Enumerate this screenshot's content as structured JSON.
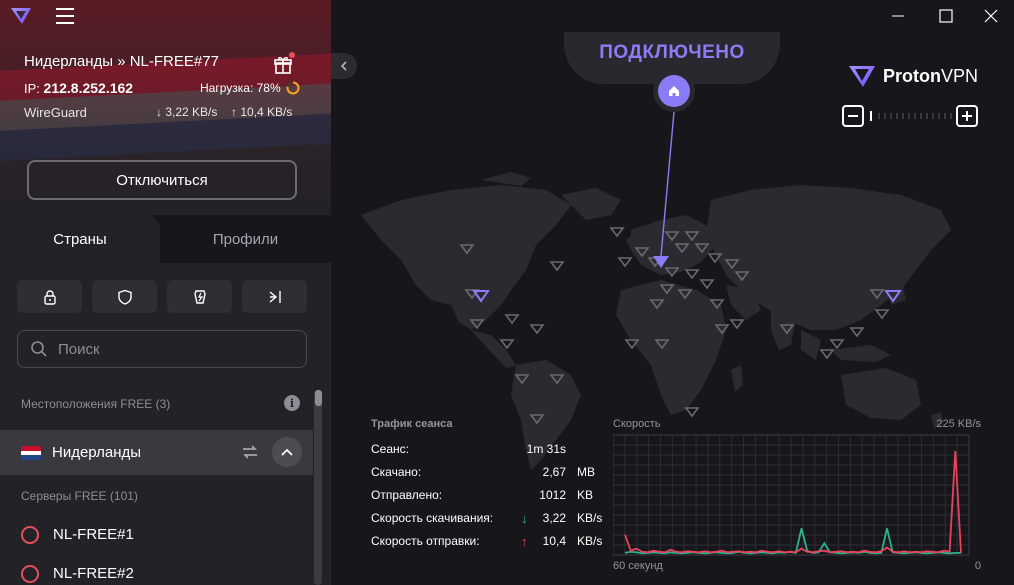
{
  "titlebar": {
    "logo_icon": "proton-vpn-logo-icon",
    "menu_icon": "hamburger-menu-icon",
    "minimize_icon": "minimize-icon",
    "maximize_icon": "maximize-icon",
    "close_icon": "close-icon"
  },
  "connection": {
    "title": "Нидерланды » NL-FREE#77",
    "ip_label": "IP:",
    "ip": "212.8.252.162",
    "load_label": "Нагрузка: 78%",
    "load_percent": 78,
    "protocol": "WireGuard",
    "download_speed": "3,22 KB/s",
    "upload_speed": "10,4 KB/s",
    "disconnect_label": "Отключиться"
  },
  "tabs": {
    "countries": "Страны",
    "profiles": "Профили"
  },
  "filters": [
    "lock-icon",
    "shield-icon",
    "p2p-icon",
    "tor-arrow-icon"
  ],
  "search": {
    "placeholder": "Поиск"
  },
  "locations": {
    "free_label": "Местоположения FREE (3)",
    "country": "Нидерланды",
    "servers_label": "Серверы FREE (101)",
    "servers": [
      "NL-FREE#1",
      "NL-FREE#2"
    ]
  },
  "map": {
    "status": "ПОДКЛЮЧЕНО",
    "brand_proton": "Proton",
    "brand_vpn": "VPN"
  },
  "session": {
    "title": "Трафик сеанса",
    "rows": [
      {
        "label": "Сеанс:",
        "arrow": "",
        "value": "1m 31s",
        "unit": ""
      },
      {
        "label": "Скачано:",
        "arrow": "",
        "value": "2,67",
        "unit": "MB"
      },
      {
        "label": "Отправлено:",
        "arrow": "",
        "value": "1012",
        "unit": "KB"
      },
      {
        "label": "Скорость скачивания:",
        "arrow": "↓",
        "value": "3,22",
        "unit": "KB/s"
      },
      {
        "label": "Скорость отправки:",
        "arrow": "↑",
        "value": "10,4",
        "unit": "KB/s"
      }
    ]
  },
  "speed_chart": {
    "title": "Скорость",
    "max_label": "225  KB/s",
    "x_left": "60 секунд",
    "x_right": "0",
    "download_color": "#2bb38f",
    "upload_color": "#e8435b"
  },
  "chart_data": {
    "type": "line",
    "title": "Скорость",
    "xlabel": "",
    "ylabel": "",
    "x_range_label": [
      "60 секунд",
      "0"
    ],
    "ylim": [
      0,
      225
    ],
    "series": [
      {
        "name": "",
        "color": "#2bb38f",
        "values": [
          4,
          6,
          5,
          3,
          4,
          5,
          4,
          3,
          5,
          4,
          3,
          4,
          5,
          4,
          3,
          4,
          5,
          4,
          3,
          4,
          6,
          4,
          3,
          4,
          5,
          4,
          3,
          5,
          4,
          6,
          4,
          50,
          8,
          4,
          5,
          22,
          5,
          4,
          3,
          4,
          5,
          4,
          6,
          4,
          3,
          4,
          50,
          5,
          4,
          3,
          4,
          5,
          4,
          3,
          4,
          5,
          4,
          3,
          4,
          4
        ]
      },
      {
        "name": "",
        "color": "#e8435b",
        "values": [
          38,
          8,
          12,
          6,
          5,
          8,
          6,
          5,
          10,
          6,
          5,
          7,
          6,
          5,
          7,
          5,
          6,
          8,
          5,
          6,
          7,
          5,
          6,
          5,
          8,
          6,
          5,
          7,
          5,
          6,
          5,
          12,
          6,
          5,
          7,
          8,
          5,
          6,
          7,
          5,
          6,
          5,
          8,
          6,
          5,
          7,
          14,
          6,
          5,
          7,
          5,
          6,
          5,
          7,
          6,
          5,
          8,
          6,
          195,
          4
        ]
      }
    ]
  }
}
